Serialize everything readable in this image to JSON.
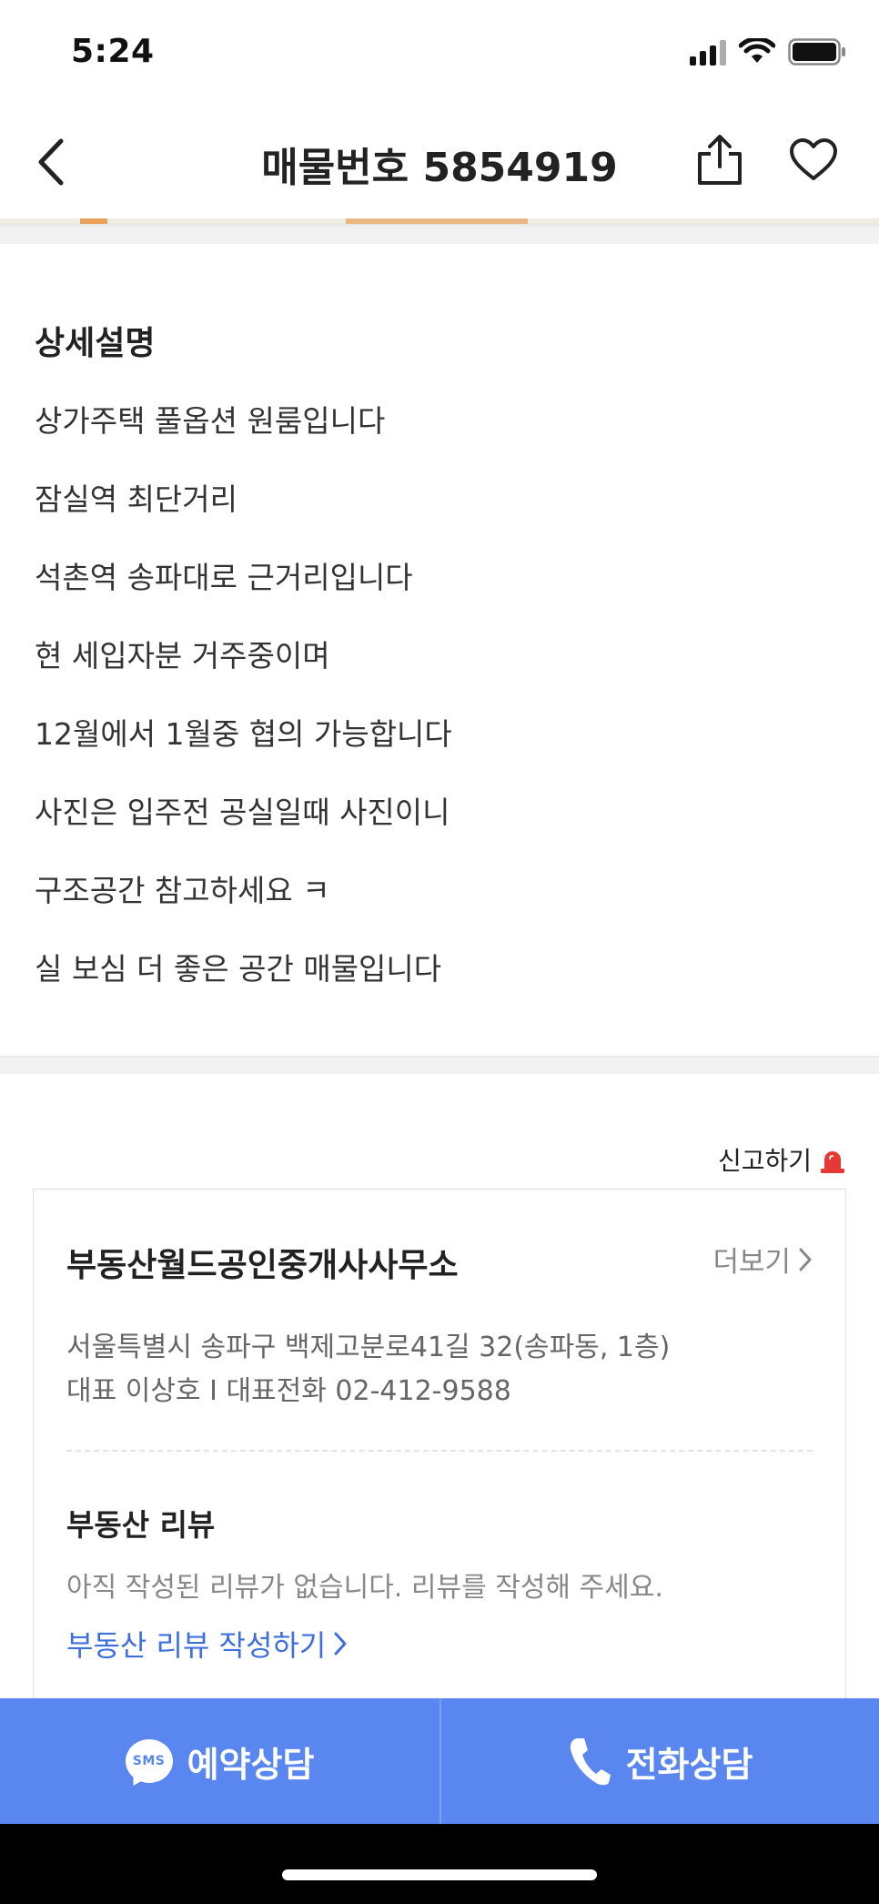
{
  "status_bar": {
    "time": "5:24"
  },
  "nav": {
    "title": "매물번호 5854919"
  },
  "description": {
    "title": "상세설명",
    "lines": [
      "상가주택 풀옵션 원룸입니다",
      "잠실역 최단거리",
      "석촌역 송파대로 근거리입니다",
      "현 세입자분 거주중이며",
      "12월에서 1월중 협의 가능합니다",
      "사진은 입주전 공실일때 사진이니",
      "구조공간 참고하세요 ㅋ",
      "실 보심 더 좋은 공간 매물입니다"
    ]
  },
  "report": {
    "label": "신고하기"
  },
  "agent": {
    "name": "부동산월드공인중개사사무소",
    "more_label": "더보기",
    "address": "서울특별시 송파구 백제고분로41길 32(송파동, 1층)",
    "contact": "대표 이상호 I 대표전화 02-412-9588"
  },
  "review": {
    "title": "부동산 리뷰",
    "empty_text": "아직 작성된 리뷰가 없습니다. 리뷰를 작성해 주세요.",
    "write_label": "부동산 리뷰 작성하기"
  },
  "bottom_bar": {
    "sms_badge": "SMS",
    "reserve_label": "예약상담",
    "call_label": "전화상담"
  },
  "colors": {
    "accent": "#5a86f0",
    "link": "#3f6fdc",
    "report_icon": "#e53935"
  },
  "icons": {
    "back": "chevron-left-icon",
    "share": "share-icon",
    "favorite": "heart-icon",
    "report": "siren-icon",
    "more": "chevron-right-icon",
    "sms": "sms-bubble-icon",
    "call": "phone-icon"
  }
}
